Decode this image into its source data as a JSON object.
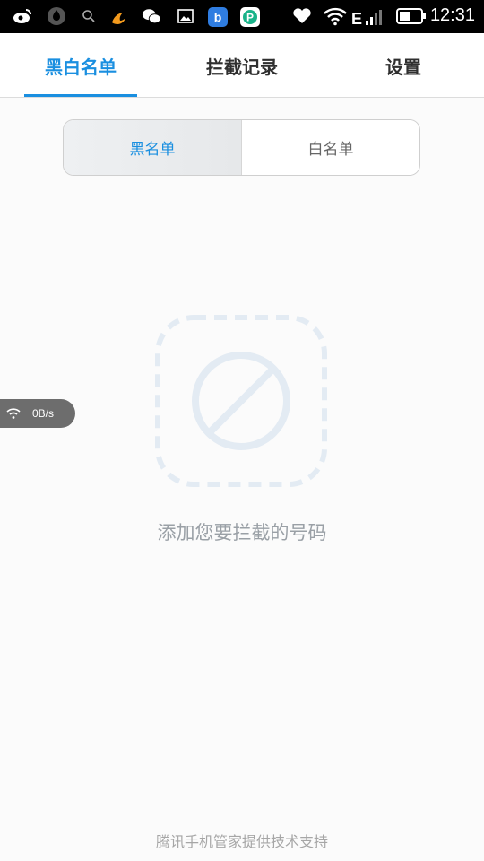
{
  "status_bar": {
    "time": "12:31",
    "left_icons": [
      "weibo-icon",
      "shield-app-icon",
      "search-icon",
      "uc-browser-icon",
      "wechat-icon",
      "gallery-icon",
      "baidu-icon",
      "p-app-icon"
    ],
    "right_icons": [
      "heart-icon",
      "wifi-icon",
      "signal-icon",
      "battery-icon"
    ],
    "network_type": "E"
  },
  "tabs": [
    {
      "label": "黑白名单",
      "active": true
    },
    {
      "label": "拦截记录",
      "active": false
    },
    {
      "label": "设置",
      "active": false
    }
  ],
  "segment": {
    "left_label": "黑名单",
    "right_label": "白名单",
    "selected": "left"
  },
  "empty_state": {
    "icon": "block-icon",
    "text": "添加您要拦截的号码"
  },
  "speed_badge": {
    "text": "0B/s"
  },
  "footer": {
    "text": "腾讯手机管家提供技术支持"
  },
  "colors": {
    "accent": "#1a8fe0",
    "status_bar": "#000000",
    "background": "#fbfbfb",
    "illustration": "#e3ebf3"
  }
}
